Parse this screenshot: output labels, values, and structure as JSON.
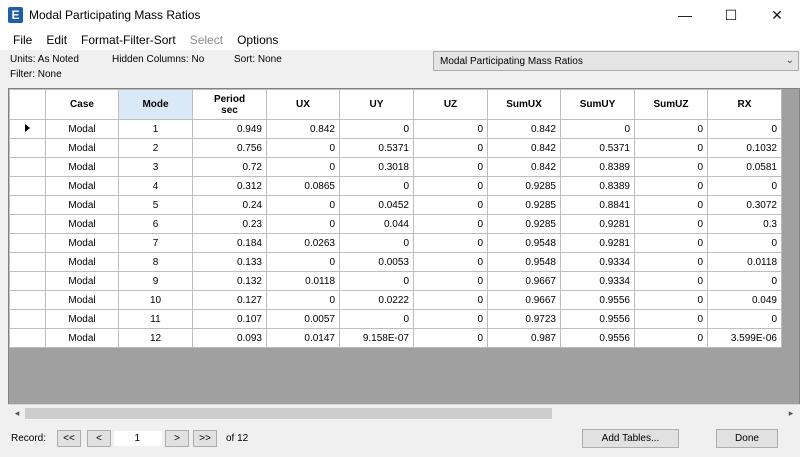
{
  "window": {
    "app_icon": "E",
    "title": "Modal Participating Mass Ratios",
    "controls": {
      "minimize": "—",
      "maximize": "☐",
      "close": "✕"
    }
  },
  "menu": [
    "File",
    "Edit",
    "Format-Filter-Sort",
    "Select",
    "Options"
  ],
  "info": {
    "units": "Units:  As Noted",
    "hidden_columns": "Hidden Columns:  No",
    "sort": "Sort:  None",
    "filter": "Filter:  None",
    "table_select": "Modal Participating Mass Ratios"
  },
  "table": {
    "columns": [
      {
        "line1": "Case",
        "line2": ""
      },
      {
        "line1": "Mode",
        "line2": ""
      },
      {
        "line1": "Period",
        "line2": "sec"
      },
      {
        "line1": "UX",
        "line2": ""
      },
      {
        "line1": "UY",
        "line2": ""
      },
      {
        "line1": "UZ",
        "line2": ""
      },
      {
        "line1": "SumUX",
        "line2": ""
      },
      {
        "line1": "SumUY",
        "line2": ""
      },
      {
        "line1": "SumUZ",
        "line2": ""
      },
      {
        "line1": "RX",
        "line2": ""
      }
    ],
    "rows": [
      [
        "Modal",
        "1",
        "0.949",
        "0.842",
        "0",
        "0",
        "0.842",
        "0",
        "0",
        "0"
      ],
      [
        "Modal",
        "2",
        "0.756",
        "0",
        "0.5371",
        "0",
        "0.842",
        "0.5371",
        "0",
        "0.1032"
      ],
      [
        "Modal",
        "3",
        "0.72",
        "0",
        "0.3018",
        "0",
        "0.842",
        "0.8389",
        "0",
        "0.0581"
      ],
      [
        "Modal",
        "4",
        "0.312",
        "0.0865",
        "0",
        "0",
        "0.9285",
        "0.8389",
        "0",
        "0"
      ],
      [
        "Modal",
        "5",
        "0.24",
        "0",
        "0.0452",
        "0",
        "0.9285",
        "0.8841",
        "0",
        "0.3072"
      ],
      [
        "Modal",
        "6",
        "0.23",
        "0",
        "0.044",
        "0",
        "0.9285",
        "0.9281",
        "0",
        "0.3"
      ],
      [
        "Modal",
        "7",
        "0.184",
        "0.0263",
        "0",
        "0",
        "0.9548",
        "0.9281",
        "0",
        "0"
      ],
      [
        "Modal",
        "8",
        "0.133",
        "0",
        "0.0053",
        "0",
        "0.9548",
        "0.9334",
        "0",
        "0.0118"
      ],
      [
        "Modal",
        "9",
        "0.132",
        "0.0118",
        "0",
        "0",
        "0.9667",
        "0.9334",
        "0",
        "0"
      ],
      [
        "Modal",
        "10",
        "0.127",
        "0",
        "0.0222",
        "0",
        "0.9667",
        "0.9556",
        "0",
        "0.049"
      ],
      [
        "Modal",
        "11",
        "0.107",
        "0.0057",
        "0",
        "0",
        "0.9723",
        "0.9556",
        "0",
        "0"
      ],
      [
        "Modal",
        "12",
        "0.093",
        "0.0147",
        "9.158E-07",
        "0",
        "0.987",
        "0.9556",
        "0",
        "3.599E-06"
      ]
    ]
  },
  "footer": {
    "record_label": "Record:",
    "first": "<<",
    "prev": "<",
    "record_value": "1",
    "next": ">",
    "last": ">>",
    "of_total": "of 12",
    "add_tables": "Add Tables...",
    "done": "Done"
  },
  "icons": {
    "row_indicator": "row-pointer-icon",
    "scroll_left": "◂",
    "scroll_right": "▸",
    "dropdown": "⌄"
  }
}
